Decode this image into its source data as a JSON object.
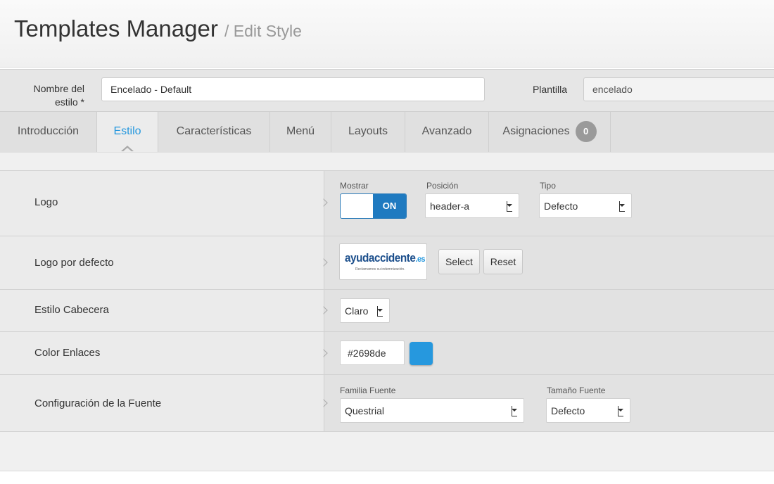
{
  "header": {
    "title": "Templates Manager",
    "subtitle": "/ Edit Style"
  },
  "name_row": {
    "name_label_line1": "Nombre del",
    "name_label_line2": "estilo *",
    "name_value": "Encelado - Default",
    "template_label": "Plantilla",
    "template_value": "encelado"
  },
  "tabs": [
    {
      "label": "Introducción"
    },
    {
      "label": "Estilo"
    },
    {
      "label": "Características"
    },
    {
      "label": "Menú"
    },
    {
      "label": "Layouts"
    },
    {
      "label": "Avanzado"
    },
    {
      "label": "Asignaciones",
      "badge": "0"
    }
  ],
  "active_tab": "Estilo",
  "rows": {
    "logo": {
      "label": "Logo",
      "show_label": "Mostrar",
      "show_value": "ON",
      "position_label": "Posición",
      "position_value": "header-a",
      "type_label": "Tipo",
      "type_value": "Defecto"
    },
    "default_logo": {
      "label": "Logo por defecto",
      "logo_text": "ayudaccidente",
      "logo_suffix": ".es",
      "logo_tagline": "Reclamamos su indemnización.",
      "select_label": "Select",
      "reset_label": "Reset"
    },
    "header_style": {
      "label": "Estilo Cabecera",
      "value": "Claro"
    },
    "link_color": {
      "label": "Color Enlaces",
      "value": "#2698de",
      "swatch_color": "#2698de"
    },
    "font_config": {
      "label": "Configuración de la Fuente",
      "family_label": "Familia Fuente",
      "family_value": "Questrial",
      "size_label": "Tamaño Fuente",
      "size_value": "Defecto"
    }
  },
  "colors": {
    "accent": "#2698de",
    "toggle_on": "#1f7ac0",
    "badge": "#9a9a9a"
  }
}
